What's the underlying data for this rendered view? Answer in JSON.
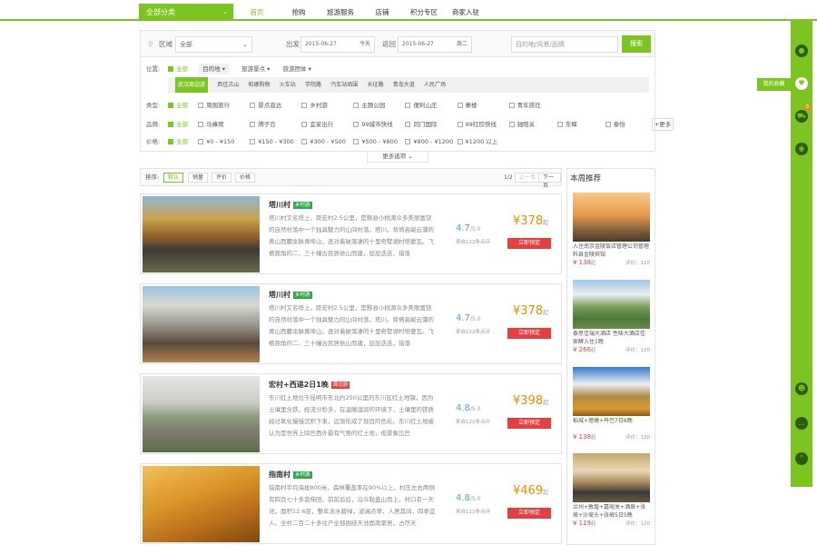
{
  "nav": {
    "category": "全部分类",
    "links": [
      "首页",
      "抢购",
      "旅游服务",
      "店铺",
      "积分专区",
      "商家入驻"
    ]
  },
  "search": {
    "region_label": "区域",
    "region_value": "全部",
    "depart_label": "出发",
    "depart_date": "2015-06-27",
    "depart_day": "今天",
    "return_label": "返回",
    "return_date": "2015-06-27",
    "return_day": "周二",
    "query_placeholder": "目的地/风景/品牌",
    "search_btn": "搜索"
  },
  "filter": {
    "location_label": "位置:",
    "all": "全部",
    "loc_tabs": [
      "目的地",
      "旅游景点",
      "旅游团体"
    ],
    "sub_items": [
      "武汉周边游",
      "西佳古山",
      "帕娜购物",
      "火车站",
      "学院路",
      "汽车站周围",
      "长征路",
      "青岛大道",
      "人民广场"
    ],
    "type_label": "类型:",
    "types": [
      "周围旅行",
      "景点直达",
      "乡村游",
      "主题公园",
      "便利山庄",
      "寨楼",
      "青年旅社"
    ],
    "brand_label": "品牌:",
    "brands": [
      "马蜂窝",
      "牌子岛",
      "宜家出行",
      "99城市快线",
      "同门国际",
      "99红饺快线",
      "驰阳关",
      "东辉",
      "泰怡"
    ],
    "more_brands": "+更多",
    "price_label": "价格:",
    "prices": [
      "¥0 - ¥150",
      "¥150 - ¥300",
      "¥300 - ¥500",
      "¥500 - ¥800",
      "¥800 - ¥1200",
      "¥1200 以上"
    ],
    "more_options": "更多选项"
  },
  "sort": {
    "label": "排序:",
    "options": [
      "默认",
      "销量",
      "评价",
      "价格"
    ],
    "page": "1/2",
    "prev": "上一页",
    "next": "下一页"
  },
  "listings": [
    {
      "title": "塔川村",
      "tag": "乡村游",
      "tag_color": "#2eab4a",
      "desc": "塔川村又名塔上，距宏村2.5公里，是黟县小桃源众多美丽富饶的自然村落中一个独具魅力的山间村落，塔川。背倚高峻云蒲的黄山西麓余脉黄埠山，逐对着破落凄的十里奇墅湖村塔夔瓦。飞檐翘角的二、三十幢古民居依山而建，层层迭迭，错落",
      "score": "4.7",
      "score_max": "/5.0",
      "reviews": "来自122条点评",
      "price": "¥378",
      "price_suffix": "起",
      "book": "立即预定"
    },
    {
      "title": "塔川村",
      "tag": "乡村游",
      "tag_color": "#2eab4a",
      "desc": "塔川村又名塔上，距宏村2.5公里，是黟县小桃源众多美丽富饶的自然村落中一个独具魅力的山间村落，塔川。背倚高峻云蒲的黄山西麓余脉黄埠山，逐对着破落凄的十里奇墅湖村塔夔瓦。飞檐翘角的二、三十幢古民居依山而建，层层迭迭，错落",
      "score": "4.7",
      "score_max": "/5.0",
      "reviews": "来自122条点评",
      "price": "¥378",
      "price_suffix": "起",
      "book": "立即预定"
    },
    {
      "title": "宏村+西递2日1晚",
      "tag": "周边游",
      "tag_color": "#e54040",
      "desc": "东川红土地位于昆明市东北约250公里的东川区红土地镇，因为土壤里含铁，经流分秒多，在温暖湿润的环境下，土壤里的铁质经过氧化慢慢沉积下来，远渐形成了现目的色彩。东川红土地被认为是世界上除巴西外最有气势的红土地，但景象比巴",
      "score": "4.8",
      "score_max": "/5.0",
      "reviews": "来自122条点评",
      "price": "¥398",
      "price_suffix": "起",
      "book": "立即预定"
    },
    {
      "title": "指南村",
      "tag": "乡村游",
      "tag_color": "#2eab4a",
      "desc": "指南村平均海拔800米，森林覆盖率在90%以上，村庄左右两侧有四百七十多亩梯田，前前后后，沿众黏盖山而上，村口有一天池，面积12.6亩，整年池水碧绿，波澜点翠，人居其间，四季宜人。全村二百二十多住户全部围绕天池面南聚居，占尽天",
      "score": "4.8",
      "score_max": "/5.0",
      "reviews": "来自122条点评",
      "price": "¥469",
      "price_suffix": "起",
      "book": "立即预定"
    }
  ],
  "recommend": {
    "title": "本周推荐",
    "items": [
      {
        "title": "入住南京金陵饭店管理公司管理料县金陵宾馆",
        "price": "¥ 138",
        "suffix": "起",
        "rating": "评价：120"
      },
      {
        "title": "泰思佳瑞大酒店\n性味大酒店佳家酵入住1晚",
        "price": "¥ 266",
        "suffix": "起",
        "rating": "评价：120"
      },
      {
        "title": "稻城+理塘+丹巴7日6晚",
        "price": "¥ 138",
        "suffix": "起",
        "rating": "评价：120"
      },
      {
        "title": "兰州+敦煌+嘉峪关+酒泉+张掖+沙坡头+张掖5日5晚",
        "price": "¥ 119",
        "suffix": "起",
        "rating": "评价：120"
      }
    ]
  },
  "sidebar": {
    "favorites": "我的收藏",
    "cart_count": "0"
  }
}
